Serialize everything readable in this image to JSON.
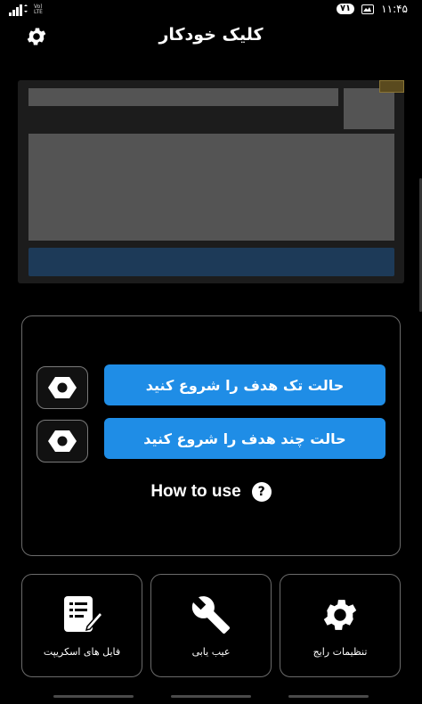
{
  "status_bar": {
    "network_label": "Vo) LTE",
    "notification_count": "۷۱",
    "time": "۱۱:۴۵"
  },
  "header": {
    "title": "کلیک خودکار",
    "settings_icon": "gear-icon"
  },
  "panel": {
    "single_target_label": "حالت تک هدف را شروع کنید",
    "multi_target_label": "حالت چند هدف را شروع کنید",
    "how_to_use_label": "How to use",
    "help_symbol": "?"
  },
  "tiles": [
    {
      "label": "فایل های اسکریپت",
      "icon": "document-edit-icon"
    },
    {
      "label": "عیب یابی",
      "icon": "wrench-icon"
    },
    {
      "label": "تنظیمات رایج",
      "icon": "gear-icon"
    }
  ],
  "colors": {
    "background": "#000000",
    "accent_blue": "#1f8de6",
    "border_gray": "#6b6b6b",
    "ad_placeholder": "#545454"
  }
}
